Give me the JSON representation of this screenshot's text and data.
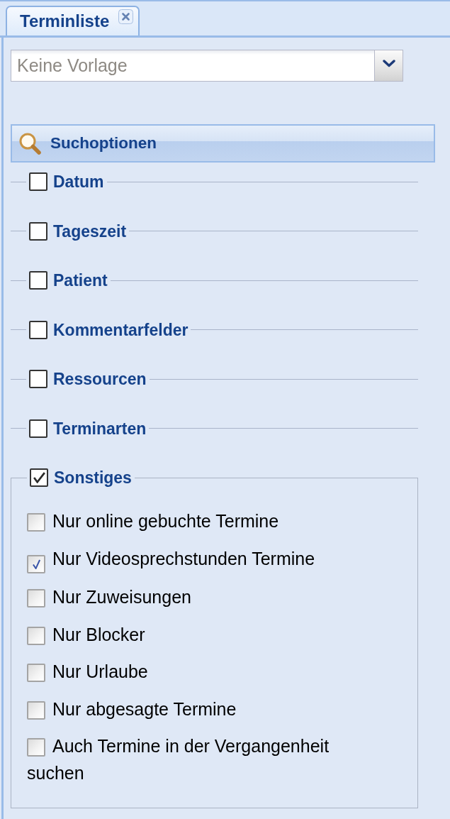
{
  "tabs": [
    {
      "label": "Terminliste",
      "selected": true
    }
  ],
  "template_select": {
    "placeholder": "Keine Vorlage"
  },
  "search_panel": {
    "title": "Suchoptionen"
  },
  "filter_groups": [
    {
      "label": "Datum",
      "checked": false
    },
    {
      "label": "Tageszeit",
      "checked": false
    },
    {
      "label": "Patient",
      "checked": false
    },
    {
      "label": "Kommentarfelder",
      "checked": false
    },
    {
      "label": "Ressourcen",
      "checked": false
    },
    {
      "label": "Terminarten",
      "checked": false
    },
    {
      "label": "Sonstiges",
      "checked": true,
      "options": [
        {
          "label": "Nur online gebuchte Termine",
          "checked": false
        },
        {
          "label": "Nur Videosprechstunden Termine",
          "checked": true
        },
        {
          "label": "Nur Zuweisungen",
          "checked": false
        },
        {
          "label": "Nur Blocker",
          "checked": false
        },
        {
          "label": "Nur Urlaube",
          "checked": false
        },
        {
          "label": "Nur abgesagte Termine",
          "checked": false
        },
        {
          "label": "Auch Termine in der Vergangenheit suchen",
          "checked": false
        }
      ]
    }
  ]
}
